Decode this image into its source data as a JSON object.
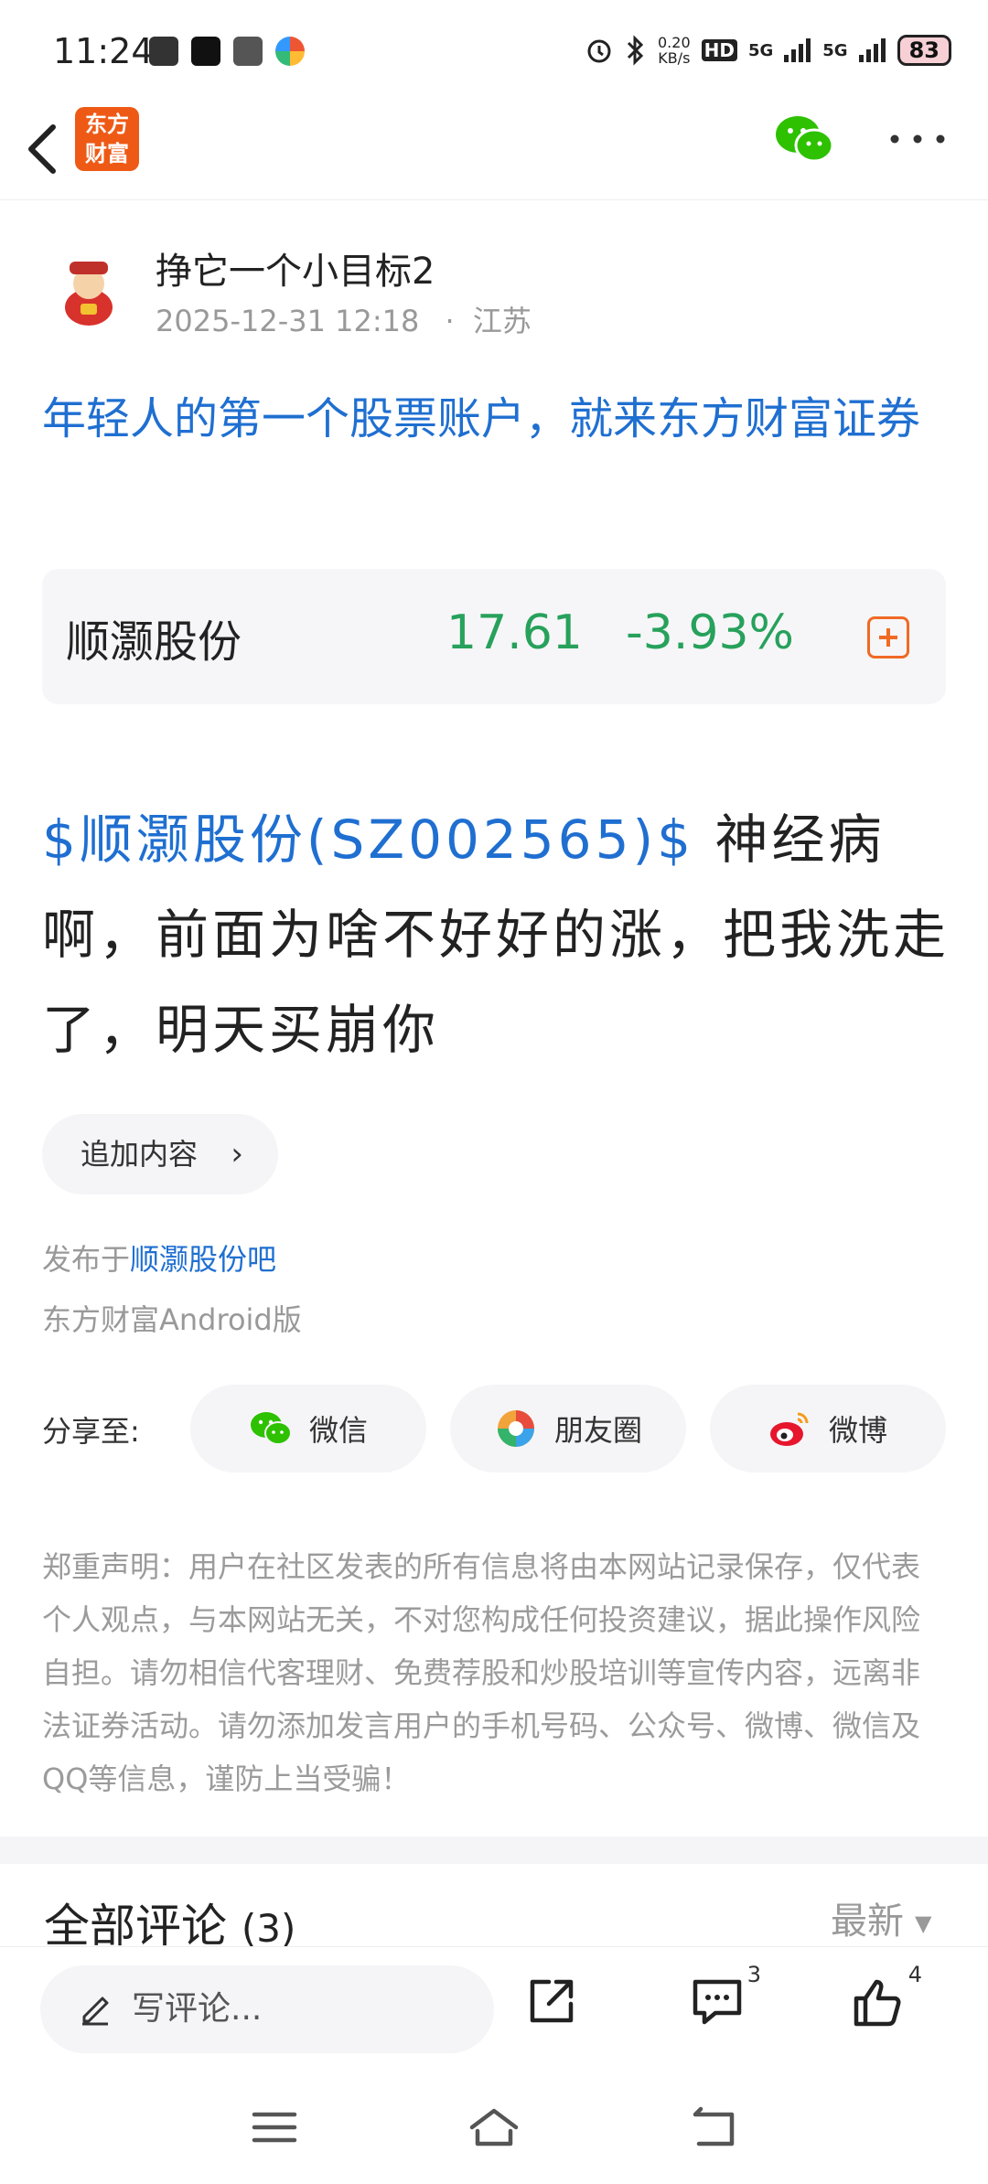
{
  "status_bar": {
    "time": "11:24",
    "net_speed_top": "0.20",
    "net_speed_bottom": "KB/s",
    "hd_label": "HD",
    "sim1": "5G",
    "sim2": "5G",
    "battery": "83",
    "icons": [
      "alarm-icon",
      "bluetooth-icon",
      "signal-icon",
      "battery-icon"
    ]
  },
  "nav": {
    "logo_line1": "东方",
    "logo_line2": "财富",
    "colors": {
      "brand": "#ee5a16",
      "wechat": "#2dc100"
    }
  },
  "author": {
    "name": "挣它一个小目标2",
    "datetime": "2025-12-31 12:18",
    "separator": "·",
    "location": "江苏"
  },
  "post": {
    "title": "年轻人的第一个股票账户，就来东方财富证券",
    "stock_tag": "$顺灏股份(SZ002565)$",
    "body_text": " 神经病啊，前面为啥不好好的涨，把我洗走了，明天买崩你"
  },
  "stock": {
    "name": "顺灏股份",
    "price": "17.61",
    "change": "-3.93%",
    "change_color": "#27a15b"
  },
  "append_button": {
    "label": "追加内容",
    "chevron": "›"
  },
  "published_in": {
    "prefix": "发布于",
    "bar_name": "顺灏股份吧"
  },
  "client": "东方财富Android版",
  "share": {
    "label": "分享至:",
    "options": [
      {
        "label": "微信",
        "icon": "wechat-icon"
      },
      {
        "label": "朋友圈",
        "icon": "moments-icon"
      },
      {
        "label": "微博",
        "icon": "weibo-icon"
      }
    ]
  },
  "disclaimer": "郑重声明：用户在社区发表的所有信息将由本网站记录保存，仅代表个人观点，与本网站无关，不对您构成任何投资建议，据此操作风险自担。请勿相信代客理财、免费荐股和炒股培训等宣传内容，远离非法证券活动。请勿添加发言用户的手机号码、公众号、微博、微信及QQ等信息，谨防上当受骗！",
  "comments": {
    "title": "全部评论",
    "count": "(3)",
    "sort": "最新",
    "sort_arrow": "▼"
  },
  "bottom_bar": {
    "input_placeholder": "写评论...",
    "comment_count": "3",
    "like_count": "4"
  }
}
